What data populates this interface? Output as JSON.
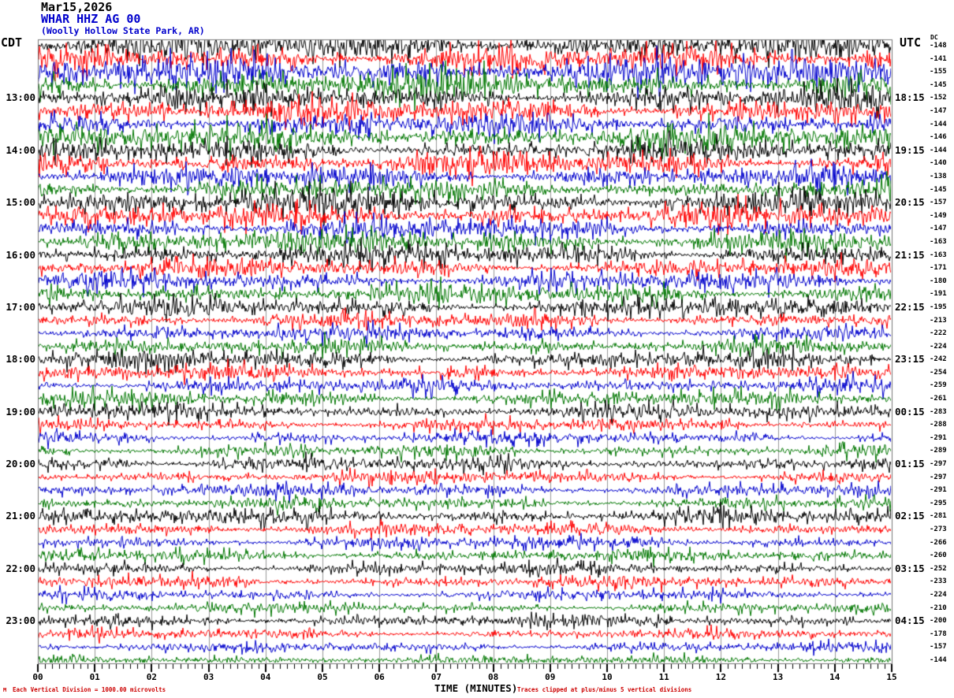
{
  "header": {
    "date": "Mar15,2026",
    "station": "WHAR HHZ AG 00",
    "location": "(Woolly Hollow State Park, AR)"
  },
  "axes": {
    "left_timezone": "CDT",
    "right_timezone": "UTC",
    "dc_label": "DC",
    "x_title": "TIME (MINUTES)",
    "x_ticks": [
      "00",
      "01",
      "02",
      "03",
      "04",
      "05",
      "06",
      "07",
      "08",
      "09",
      "10",
      "11",
      "12",
      "13",
      "14",
      "15"
    ]
  },
  "footer": {
    "logo": "M",
    "scale_note": "Each Vertical Division = 1000.00 microvolts",
    "clip_note": "Traces clipped at plus/minus 5 vertical divisions"
  },
  "colors": {
    "black": "#000000",
    "red": "#ff0000",
    "blue": "#0000cc",
    "green": "#007700",
    "grid": "#999999",
    "border": "#777777",
    "accent_text": "#0000cc",
    "note_red": "#cc0000"
  },
  "chart_data": {
    "type": "line",
    "kind": "seismogram-helicorder",
    "x_axis": {
      "label": "TIME (MINUTES)",
      "min": 0,
      "max": 15,
      "major_tick_minutes": 1,
      "minor_divisions_per_minute": 8
    },
    "rows_per_hour": 4,
    "minutes_per_row": 15,
    "color_cycle": [
      "black",
      "red",
      "blue",
      "green"
    ],
    "traces": [
      {
        "color": "black",
        "dc": -148,
        "amp": 11,
        "left": "",
        "right": ""
      },
      {
        "color": "red",
        "dc": -141,
        "amp": 10,
        "left": "",
        "right": ""
      },
      {
        "color": "blue",
        "dc": -155,
        "amp": 12,
        "left": "",
        "right": ""
      },
      {
        "color": "green",
        "dc": -145,
        "amp": 11,
        "left": "",
        "right": ""
      },
      {
        "color": "black",
        "dc": -152,
        "amp": 9,
        "left": "13:00",
        "right": "18:15"
      },
      {
        "color": "red",
        "dc": -147,
        "amp": 10,
        "left": "",
        "right": ""
      },
      {
        "color": "blue",
        "dc": -144,
        "amp": 9,
        "left": "",
        "right": ""
      },
      {
        "color": "green",
        "dc": -146,
        "amp": 10,
        "left": "",
        "right": ""
      },
      {
        "color": "black",
        "dc": -144,
        "amp": 8,
        "left": "14:00",
        "right": "19:15"
      },
      {
        "color": "red",
        "dc": -140,
        "amp": 9,
        "left": "",
        "right": ""
      },
      {
        "color": "blue",
        "dc": -138,
        "amp": 8,
        "left": "",
        "right": ""
      },
      {
        "color": "green",
        "dc": -145,
        "amp": 8,
        "left": "",
        "right": ""
      },
      {
        "color": "black",
        "dc": -157,
        "amp": 10,
        "left": "15:00",
        "right": "20:15"
      },
      {
        "color": "red",
        "dc": -149,
        "amp": 9,
        "left": "",
        "right": ""
      },
      {
        "color": "blue",
        "dc": -147,
        "amp": 8,
        "left": "",
        "right": ""
      },
      {
        "color": "green",
        "dc": -163,
        "amp": 9,
        "left": "",
        "right": ""
      },
      {
        "color": "black",
        "dc": -163,
        "amp": 8,
        "left": "16:00",
        "right": "21:15"
      },
      {
        "color": "red",
        "dc": -171,
        "amp": 7,
        "left": "",
        "right": ""
      },
      {
        "color": "blue",
        "dc": -180,
        "amp": 7,
        "left": "",
        "right": ""
      },
      {
        "color": "green",
        "dc": -191,
        "amp": 8,
        "left": "",
        "right": ""
      },
      {
        "color": "black",
        "dc": -195,
        "amp": 7,
        "left": "17:00",
        "right": "22:15"
      },
      {
        "color": "red",
        "dc": -213,
        "amp": 6,
        "left": "",
        "right": ""
      },
      {
        "color": "blue",
        "dc": -222,
        "amp": 6,
        "left": "",
        "right": ""
      },
      {
        "color": "green",
        "dc": -224,
        "amp": 6,
        "left": "",
        "right": ""
      },
      {
        "color": "black",
        "dc": -242,
        "amp": 7,
        "left": "18:00",
        "right": "23:15"
      },
      {
        "color": "red",
        "dc": -254,
        "amp": 6,
        "left": "",
        "right": ""
      },
      {
        "color": "blue",
        "dc": -259,
        "amp": 6,
        "left": "",
        "right": ""
      },
      {
        "color": "green",
        "dc": -261,
        "amp": 6,
        "left": "",
        "right": ""
      },
      {
        "color": "black",
        "dc": -283,
        "amp": 6,
        "left": "19:00",
        "right": "00:15"
      },
      {
        "color": "red",
        "dc": -288,
        "amp": 5,
        "left": "",
        "right": ""
      },
      {
        "color": "blue",
        "dc": -291,
        "amp": 5,
        "left": "",
        "right": ""
      },
      {
        "color": "green",
        "dc": -289,
        "amp": 5,
        "left": "",
        "right": ""
      },
      {
        "color": "black",
        "dc": -297,
        "amp": 6,
        "left": "20:00",
        "right": "01:15"
      },
      {
        "color": "red",
        "dc": -297,
        "amp": 5,
        "left": "",
        "right": ""
      },
      {
        "color": "blue",
        "dc": -291,
        "amp": 5,
        "left": "",
        "right": ""
      },
      {
        "color": "green",
        "dc": -295,
        "amp": 5,
        "left": "",
        "right": ""
      },
      {
        "color": "black",
        "dc": -281,
        "amp": 6,
        "left": "21:00",
        "right": "02:15"
      },
      {
        "color": "red",
        "dc": -273,
        "amp": 5,
        "left": "",
        "right": ""
      },
      {
        "color": "blue",
        "dc": -266,
        "amp": 5,
        "left": "",
        "right": ""
      },
      {
        "color": "green",
        "dc": -260,
        "amp": 5,
        "left": "",
        "right": ""
      },
      {
        "color": "black",
        "dc": -252,
        "amp": 5,
        "left": "22:00",
        "right": "03:15"
      },
      {
        "color": "red",
        "dc": -233,
        "amp": 5,
        "left": "",
        "right": ""
      },
      {
        "color": "blue",
        "dc": -224,
        "amp": 4,
        "left": "",
        "right": ""
      },
      {
        "color": "green",
        "dc": -210,
        "amp": 4,
        "left": "",
        "right": ""
      },
      {
        "color": "black",
        "dc": -200,
        "amp": 5,
        "left": "23:00",
        "right": "04:15"
      },
      {
        "color": "red",
        "dc": -178,
        "amp": 4,
        "left": "",
        "right": ""
      },
      {
        "color": "blue",
        "dc": -157,
        "amp": 4,
        "left": "",
        "right": ""
      },
      {
        "color": "green",
        "dc": -144,
        "amp": 4,
        "left": "",
        "right": ""
      }
    ]
  }
}
